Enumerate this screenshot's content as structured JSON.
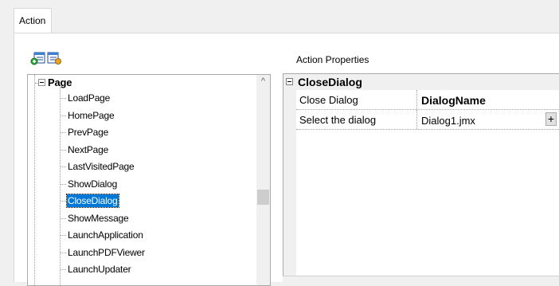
{
  "tab": {
    "label": "Action"
  },
  "toolbar": {
    "add_icon": "add-action-icon",
    "edit_icon": "edit-action-icon"
  },
  "action_properties": {
    "label": "Action Properties"
  },
  "tree": {
    "root": "Page",
    "items": [
      "LoadPage",
      "HomePage",
      "PrevPage",
      "NextPage",
      "LastVisitedPage",
      "ShowDialog",
      "CloseDialog",
      "ShowMessage",
      "LaunchApplication",
      "LaunchPDFViewer",
      "LaunchUpdater"
    ],
    "selected": "CloseDialog",
    "scroll_up_glyph": "^"
  },
  "property_grid": {
    "category": "CloseDialog",
    "rows": [
      {
        "name": "Close Dialog",
        "value": "DialogName"
      },
      {
        "name": "Select the dialog",
        "value": "Dialog1.jmx",
        "button": "+"
      }
    ]
  },
  "colors": {
    "selection": "#0078d7",
    "background": "#f0f0f0"
  }
}
